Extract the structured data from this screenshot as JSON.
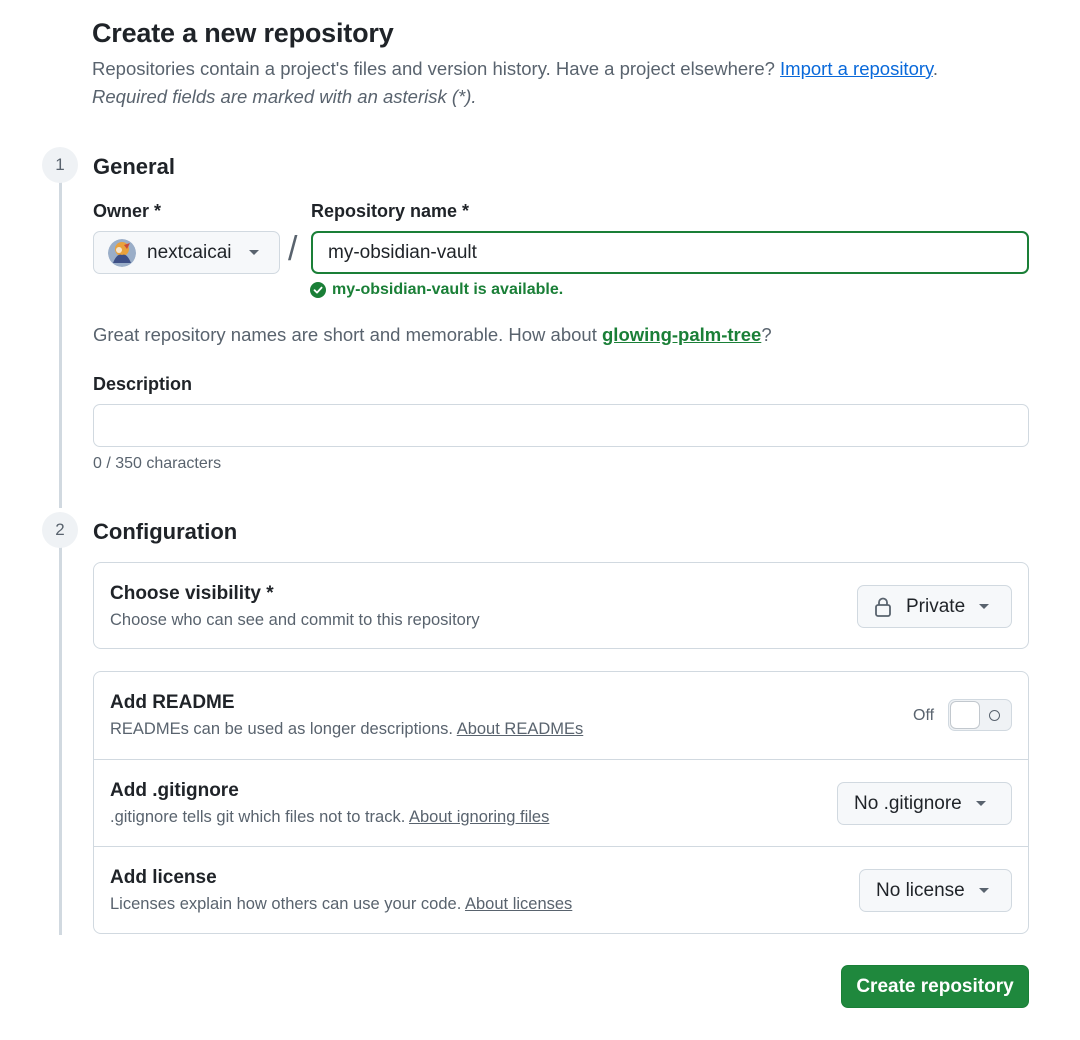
{
  "header": {
    "title": "Create a new repository",
    "intro_text": "Repositories contain a project's files and version history. Have a project elsewhere?",
    "import_link": "Import a repository",
    "intro_end": ".",
    "required_note": "Required fields are marked with an asterisk (*)."
  },
  "steps": [
    {
      "number": "1",
      "title": "General"
    },
    {
      "number": "2",
      "title": "Configuration"
    }
  ],
  "general": {
    "owner_label": "Owner *",
    "owner_value": "nextcaicai",
    "repo_name_label": "Repository name *",
    "repo_name_value": "my-obsidian-vault",
    "availability_text": "my-obsidian-vault is available.",
    "suggestion_text": "Great repository names are short and memorable. How about",
    "suggestion_link": "glowing-palm-tree",
    "suggestion_end": "?",
    "description_label": "Description",
    "description_value": "",
    "char_counter": "0 / 350 characters"
  },
  "configuration": {
    "visibility": {
      "title": "Choose visibility *",
      "subtitle": "Choose who can see and commit to this repository",
      "value": "Private",
      "icon": "lock-icon"
    },
    "readme": {
      "title": "Add README",
      "subtitle": "READMEs can be used as longer descriptions.",
      "link": "About READMEs",
      "toggle_label": "Off",
      "enabled": false
    },
    "gitignore": {
      "title": "Add .gitignore",
      "subtitle": ".gitignore tells git which files not to track.",
      "link": "About ignoring files",
      "value": "No .gitignore"
    },
    "license": {
      "title": "Add license",
      "subtitle": "Licenses explain how others can use your code.",
      "link": "About licenses",
      "value": "No license"
    }
  },
  "actions": {
    "create_label": "Create repository"
  },
  "colors": {
    "success": "#1a7f37",
    "primary_button": "#1f883d",
    "link": "#0969da",
    "muted": "#59636e",
    "border": "#d1d9e0"
  }
}
